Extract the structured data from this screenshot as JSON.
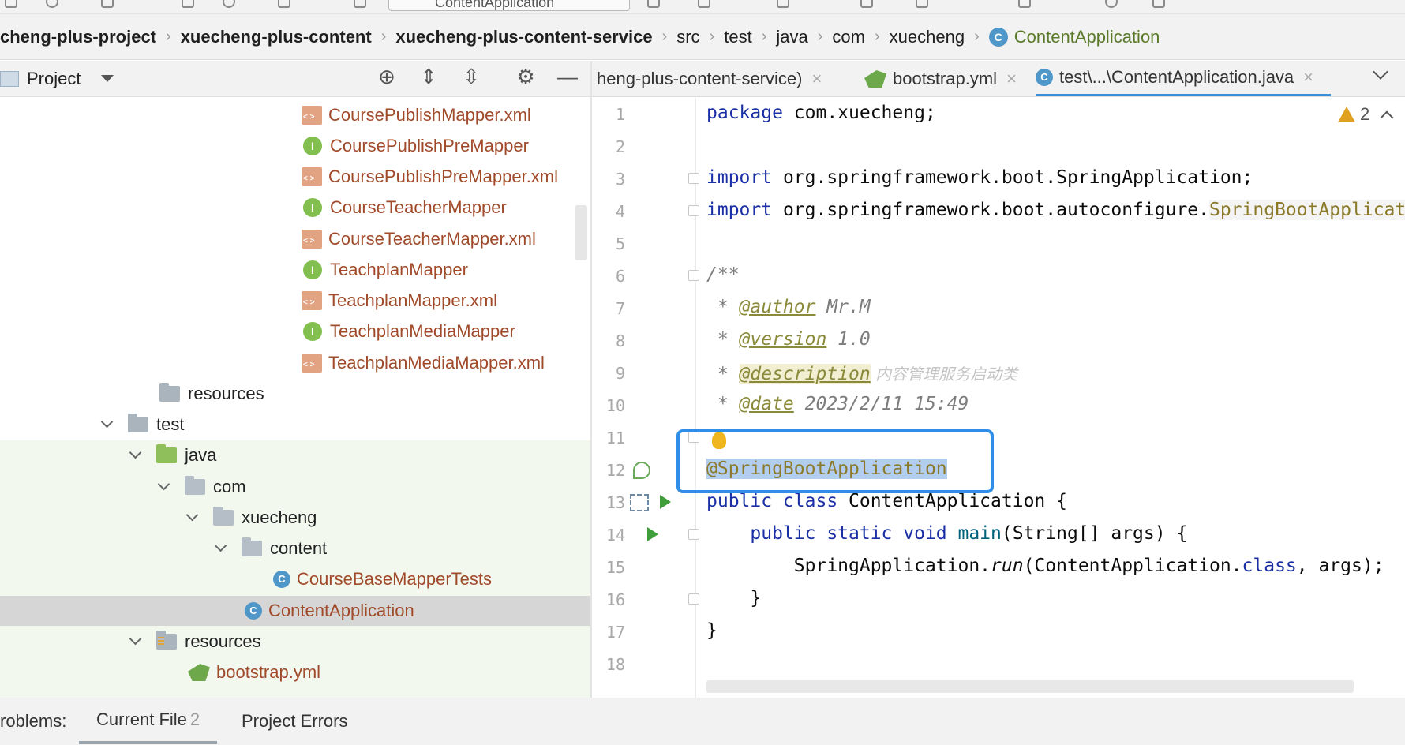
{
  "toolbar": {
    "run_config_label": "ContentApplication"
  },
  "breadcrumb": {
    "items": [
      "cheng-plus-project",
      "xuecheng-plus-content",
      "xuecheng-plus-content-service",
      "src",
      "test",
      "java",
      "com",
      "xuecheng",
      "ContentApplication"
    ]
  },
  "project_panel": {
    "title": "Project"
  },
  "tree": {
    "items": [
      {
        "label": "CoursePublishMapper.xml",
        "type": "xml"
      },
      {
        "label": "CoursePublishPreMapper",
        "type": "interface"
      },
      {
        "label": "CoursePublishPreMapper.xml",
        "type": "xml"
      },
      {
        "label": "CourseTeacherMapper",
        "type": "interface"
      },
      {
        "label": "CourseTeacherMapper.xml",
        "type": "xml"
      },
      {
        "label": "TeachplanMapper",
        "type": "interface"
      },
      {
        "label": "TeachplanMapper.xml",
        "type": "xml"
      },
      {
        "label": "TeachplanMediaMapper",
        "type": "interface"
      },
      {
        "label": "TeachplanMediaMapper.xml",
        "type": "xml"
      },
      {
        "label": "resources",
        "type": "folder"
      },
      {
        "label": "test",
        "type": "folder"
      },
      {
        "label": "java",
        "type": "source-folder"
      },
      {
        "label": "com",
        "type": "package"
      },
      {
        "label": "xuecheng",
        "type": "package"
      },
      {
        "label": "content",
        "type": "package"
      },
      {
        "label": "CourseBaseMapperTests",
        "type": "class"
      },
      {
        "label": "ContentApplication",
        "type": "class",
        "selected": true
      },
      {
        "label": "resources",
        "type": "resources-folder"
      },
      {
        "label": "bootstrap.yml",
        "type": "yml"
      }
    ]
  },
  "tabs": [
    {
      "label": "heng-plus-content-service)",
      "active": false
    },
    {
      "label": "bootstrap.yml",
      "active": false
    },
    {
      "label": "test\\...\\ContentApplication.java",
      "active": true
    }
  ],
  "editor": {
    "warning_count": "2",
    "line_numbers": [
      "1",
      "2",
      "3",
      "4",
      "5",
      "6",
      "7",
      "8",
      "9",
      "10",
      "11",
      "12",
      "13",
      "14",
      "15",
      "16",
      "17",
      "18"
    ],
    "code": {
      "l1_kw": "package",
      "l1_rest": " com.xuecheng;",
      "l3_kw": "import",
      "l3_rest": " org.springframework.boot.SpringApplication;",
      "l4_kw": "import",
      "l4_rest": " org.springframework.boot.autoconfigure.",
      "l4_tail": "SpringBootApplicat",
      "l6": "/**",
      "l7_star": " * ",
      "l7_tag": "@author",
      "l7_val": " Mr.M",
      "l8_star": " * ",
      "l8_tag": "@version",
      "l8_val": " 1.0",
      "l9_star": " * ",
      "l9_tag": "@description",
      "l9_val": " 内容管理服务启动类",
      "l10_star": " * ",
      "l10_tag": "@date",
      "l10_val": " 2023/2/11 15:49",
      "l12_sel": "@SpringBootApplication",
      "l13_kw": "public class",
      "l13_rest": " ContentApplication {",
      "l14_kw": "    public static void",
      "l14_method": " main",
      "l14_rest": "(String[] args) {",
      "l15_a": "        SpringApplication.",
      "l15_run": "run",
      "l15_b": "(ContentApplication.",
      "l15_cls": "class",
      "l15_c": ", args);",
      "l16": "    }",
      "l17": "}"
    }
  },
  "problems": {
    "label": "roblems:",
    "tabs": [
      {
        "label": "Current File",
        "count": "2",
        "active": true
      },
      {
        "label": "Project Errors",
        "count": "",
        "active": false
      }
    ]
  }
}
